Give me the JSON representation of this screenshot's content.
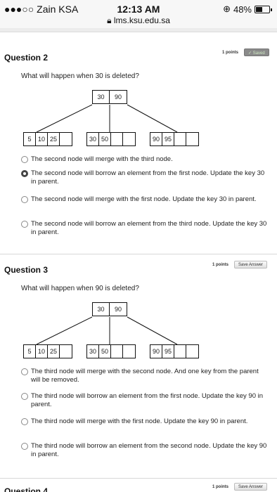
{
  "status_bar": {
    "carrier": "●●●○○ Zain KSA",
    "time": "12:13 AM",
    "battery": "48%",
    "battery_level": 0.48,
    "url": "lms.ksu.edu.sa"
  },
  "questions": [
    {
      "title": "Question 2",
      "points": "1 points",
      "button": "✓ Saved",
      "prompt": "What will happen when 30 is deleted?",
      "tree": {
        "root": [
          "30",
          "90"
        ],
        "children": [
          [
            "5",
            "10",
            "25"
          ],
          [
            "30",
            "50",
            ""
          ],
          [
            "90",
            "95",
            ""
          ]
        ]
      },
      "options": [
        {
          "text": "The second node will merge with the third node.",
          "selected": false
        },
        {
          "text": "The second node will borrow an element from the first node. Update the key 30 in parent.",
          "selected": true
        },
        {
          "text": "The second node will merge with the first node. Update the key 30 in parent.",
          "selected": false
        },
        {
          "text": "The second node will borrow an element from the third node. Update the key 30 in parent.",
          "selected": false
        }
      ]
    },
    {
      "title": "Question 3",
      "points": "1 points",
      "button": "Save Answer",
      "prompt": "What will happen when 90 is deleted?",
      "tree": {
        "root": [
          "30",
          "90"
        ],
        "children": [
          [
            "5",
            "10",
            "25"
          ],
          [
            "30",
            "50",
            ""
          ],
          [
            "90",
            "95",
            ""
          ]
        ]
      },
      "options": [
        {
          "text": "The third node will merge with the second node. And one key from the parent will be removed.",
          "selected": false
        },
        {
          "text": "The third node will borrow an element from the first node. Update the key 90 in parent.",
          "selected": false
        },
        {
          "text": "The third node will merge with the first node. Update the key 90 in parent.",
          "selected": false
        },
        {
          "text": "The third node will borrow an element from the second node. Update the key 90 in parent.",
          "selected": false
        }
      ]
    },
    {
      "title": "Question 4",
      "points": "1 points",
      "button": "Save Answer"
    }
  ]
}
